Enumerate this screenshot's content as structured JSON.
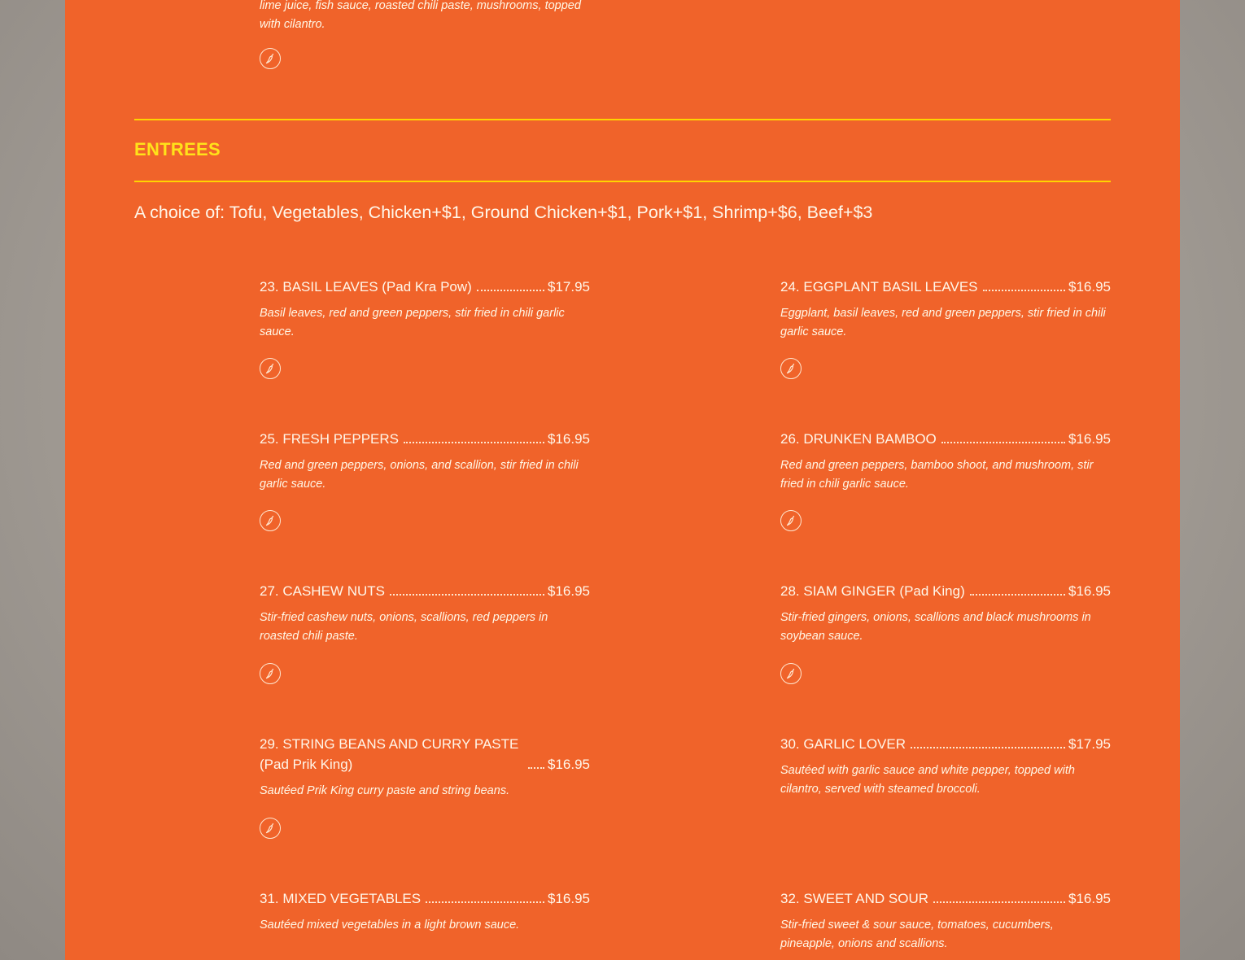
{
  "top_item": {
    "description": "lime juice, fish sauce, roasted chili paste, mushrooms, topped with cilantro."
  },
  "section": {
    "title": "ENTREES",
    "choice": "A choice of: Tofu, Vegetables, Chicken+$1, Ground Chicken+$1, Pork+$1, Shrimp+$6, Beef+$3"
  },
  "items": [
    {
      "name": "23. BASIL LEAVES (Pad Kra Pow)",
      "price": "$17.95",
      "description": "Basil leaves, red and green peppers, stir fried in chili garlic sauce.",
      "spicy": true
    },
    {
      "name": "24. EGGPLANT BASIL LEAVES",
      "price": "$16.95",
      "description": "Eggplant, basil leaves, red and green peppers, stir fried in chili garlic sauce.",
      "spicy": true
    },
    {
      "name": "25. FRESH PEPPERS",
      "price": "$16.95",
      "description": "Red and green peppers, onions, and scallion, stir fried in chili garlic sauce.",
      "spicy": true
    },
    {
      "name": "26. DRUNKEN BAMBOO",
      "price": "$16.95",
      "description": "Red and green peppers, bamboo shoot, and mushroom, stir fried in chili garlic sauce.",
      "spicy": true
    },
    {
      "name": "27. CASHEW NUTS",
      "price": "$16.95",
      "description": "Stir-fried cashew nuts, onions, scallions, red peppers in roasted chili paste.",
      "spicy": true
    },
    {
      "name": "28. SIAM GINGER (Pad King)",
      "price": "$16.95",
      "description": "Stir-fried gingers, onions, scallions and black mushrooms in soybean sauce.",
      "spicy": true
    },
    {
      "name": "29. STRING BEANS AND CURRY PASTE (Pad Prik King)",
      "price": "$16.95",
      "description": "Sautéed Prik King curry paste and string beans.",
      "spicy": true
    },
    {
      "name": "30. GARLIC LOVER",
      "price": "$17.95",
      "description": "Sautéed with garlic sauce and white pepper, topped with cilantro, served with steamed broccoli.",
      "spicy": false
    },
    {
      "name": "31. MIXED VEGETABLES",
      "price": "$16.95",
      "description": "Sautéed mixed vegetables in a light brown sauce.",
      "spicy": false
    },
    {
      "name": "32. SWEET AND SOUR",
      "price": "$16.95",
      "description": "Stir-fried sweet & sour sauce, tomatoes, cucumbers, pineapple, onions and scallions.",
      "spicy": false
    }
  ],
  "icons": {
    "spicy": "chili-pepper-icon"
  },
  "colors": {
    "panel": "#f0632a",
    "accent": "#ffd400",
    "text": "#fff7ea"
  }
}
